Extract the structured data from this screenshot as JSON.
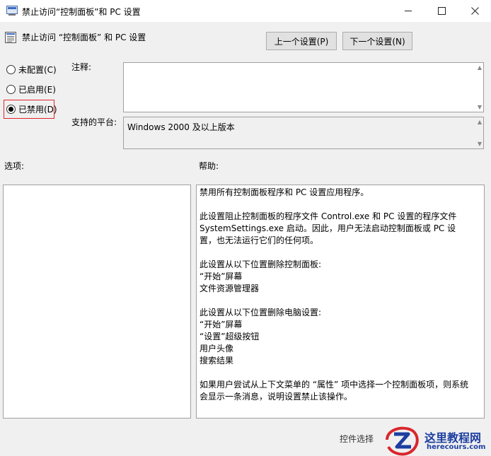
{
  "window": {
    "title": "禁止访问“控制面板”和 PC 设置"
  },
  "header": {
    "title": "禁止访问 “控制面板” 和 PC 设置"
  },
  "nav": {
    "prev_label": "上一个设置(P)",
    "next_label": "下一个设置(N)"
  },
  "radios": [
    {
      "label": "未配置(C)",
      "checked": false
    },
    {
      "label": "已启用(E)",
      "checked": false
    },
    {
      "label": "已禁用(D)",
      "checked": true
    }
  ],
  "comment": {
    "label": "注释:",
    "value": ""
  },
  "platform": {
    "label": "支持的平台:",
    "value": "Windows 2000 及以上版本"
  },
  "options": {
    "label": "选项:"
  },
  "help": {
    "label": "帮助:",
    "text": "禁用所有控制面板程序和 PC 设置应用程序。\n\n此设置阻止控制面板的程序文件 Control.exe 和 PC 设置的程序文件 SystemSettings.exe 启动。因此，用户无法启动控制面板或 PC 设置，也无法运行它们的任何项。\n\n此设置从以下位置删除控制面板:\n“开始”屏幕\n文件资源管理器\n\n此设置从以下位置删除电脑设置:\n“开始”屏幕\n“设置”超级按钮\n用户头像\n搜索结果\n\n如果用户尝试从上下文菜单的 “属性” 项中选择一个控制面板项，则系统会显示一条消息，说明设置禁止该操作。"
  },
  "footer": {
    "text": "控件选择"
  },
  "watermark": {
    "line1": "这里教程网",
    "line2": "herecours.com"
  },
  "colors": {
    "highlight": "#e0242c",
    "watermark": "#1d3ea0"
  }
}
